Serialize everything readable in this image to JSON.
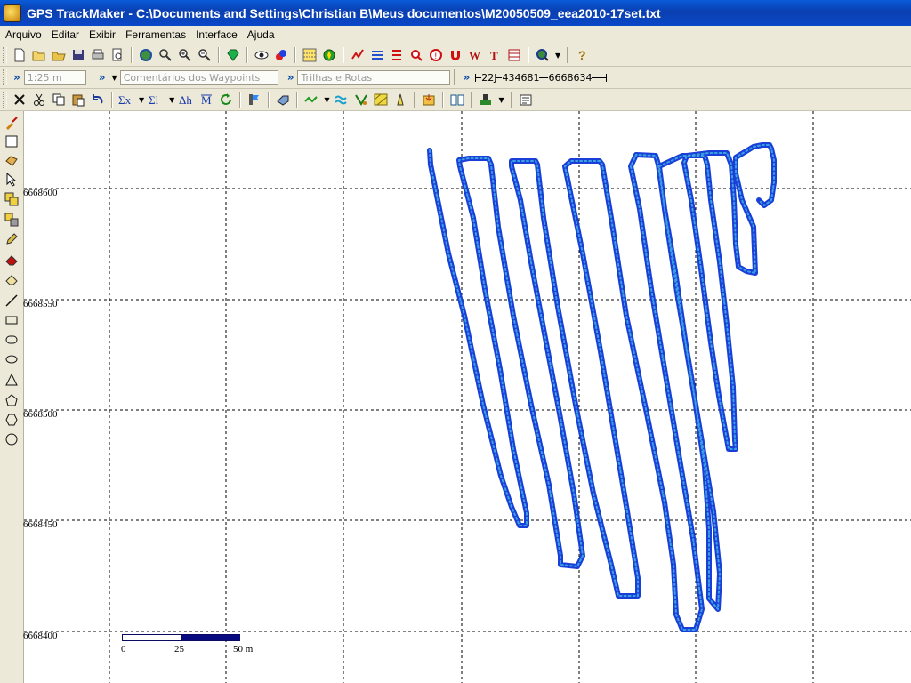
{
  "window": {
    "title": "GPS TrackMaker - C:\\Documents and Settings\\Christian B\\Meus documentos\\M20050509_eea2010-17set.txt"
  },
  "menu": [
    "Arquivo",
    "Editar",
    "Exibir",
    "Ferramentas",
    "Interface",
    "Ajuda"
  ],
  "toolbar2": {
    "scale_placeholder": "1:25 m",
    "waypoints_placeholder": "Comentários dos Waypoints",
    "tracks_placeholder": "Trilhas e Rotas",
    "zone": "22J",
    "easting": "434681",
    "northing": "6668634"
  },
  "map": {
    "y_labels": [
      "6668600",
      "6668550",
      "6668500",
      "6668450",
      "6668400"
    ],
    "scale_bar": {
      "labels": [
        "0",
        "25",
        "50 m"
      ]
    },
    "track_color": "#1a3fd8",
    "track_outline": "#1f49c9"
  },
  "icons": {
    "toolbar1": [
      "new-file-icon",
      "open-folder-icon",
      "open-icon",
      "save-icon",
      "print-icon",
      "print-preview-icon",
      "globe-icon",
      "zoom-icon",
      "zoom-in-icon",
      "zoom-out-icon",
      "gem-icon",
      "view-eye-icon",
      "color-icon",
      "grid-icon",
      "compass-icon",
      "track-tool-icon",
      "route-icon",
      "waypoint-icon",
      "search-icon",
      "info-icon",
      "magnet-icon",
      "text-icon",
      "table-icon",
      "globe-find-icon",
      "help-icon"
    ],
    "toolbar3": [
      "delete-icon",
      "cut-icon",
      "copy-icon",
      "paste-icon",
      "undo-icon",
      "sum-x-icon",
      "sum-l-icon",
      "delta-icon",
      "mean-icon",
      "refresh-icon",
      "flag-icon",
      "send-icon",
      "track-icon",
      "waves-icon",
      "filter-icon",
      "hatch-icon",
      "road-icon",
      "import-icon",
      "book-icon",
      "paint-icon",
      "properties-icon"
    ],
    "left": [
      "paint-brush-icon",
      "select-rect-icon",
      "pan-icon",
      "pointer-icon",
      "layer-icon",
      "layers-icon",
      "pencil-icon",
      "eraser-red-icon",
      "eraser-icon",
      "line-icon",
      "rectangle-icon",
      "rounded-rect-icon",
      "ellipse-icon",
      "triangle-icon",
      "pentagon-icon",
      "hexagon-icon",
      "circle-icon"
    ]
  }
}
